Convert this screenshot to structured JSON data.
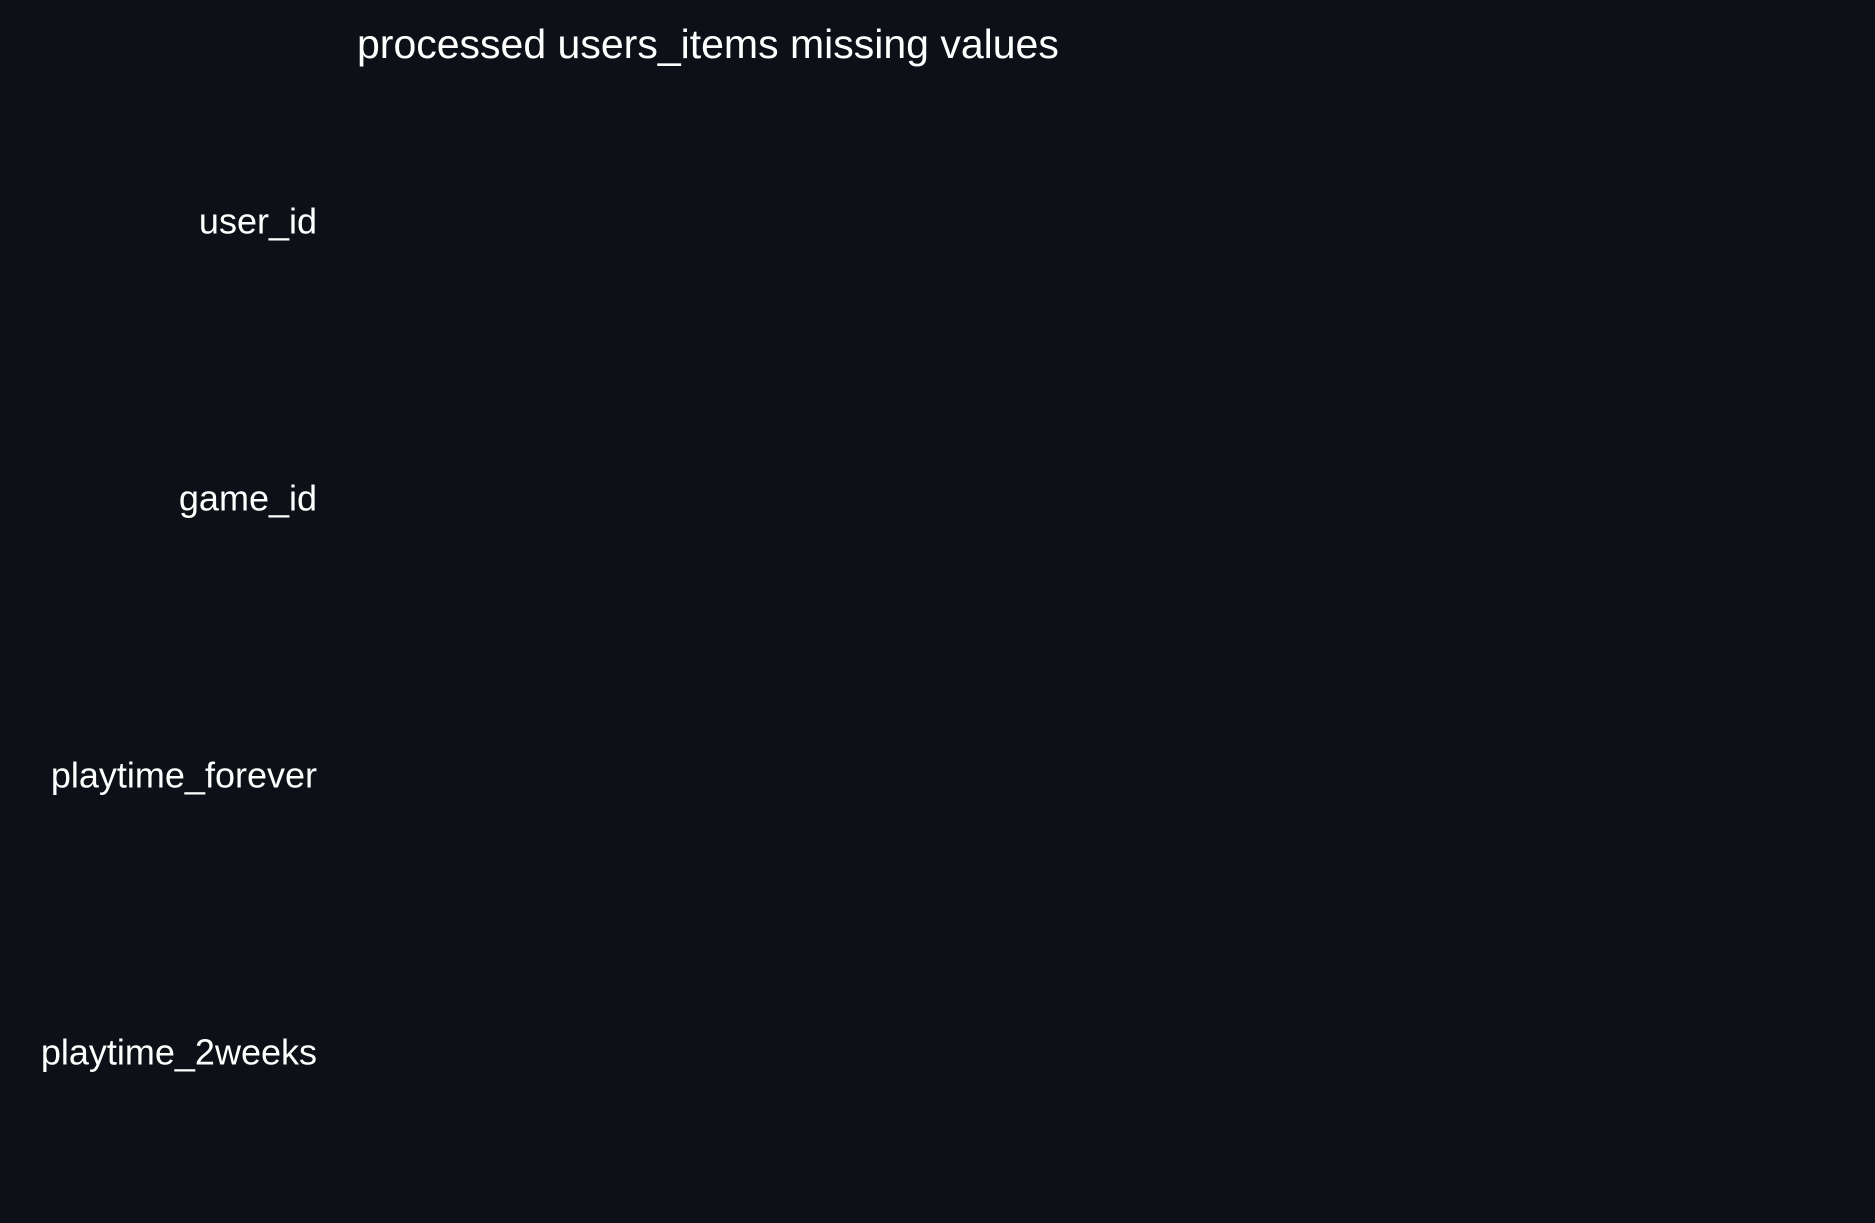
{
  "chart_data": {
    "type": "bar",
    "orientation": "horizontal",
    "title": "processed users_items missing values",
    "xlabel": "",
    "ylabel": "",
    "categories": [
      "user_id",
      "game_id",
      "playtime_forever",
      "playtime_2weeks"
    ],
    "values": [
      0,
      0,
      0,
      0
    ],
    "grid": false,
    "legend": "none",
    "colors": {
      "background": "#0d1117",
      "text": "#ffffff",
      "bar": "#1f77b4"
    }
  }
}
